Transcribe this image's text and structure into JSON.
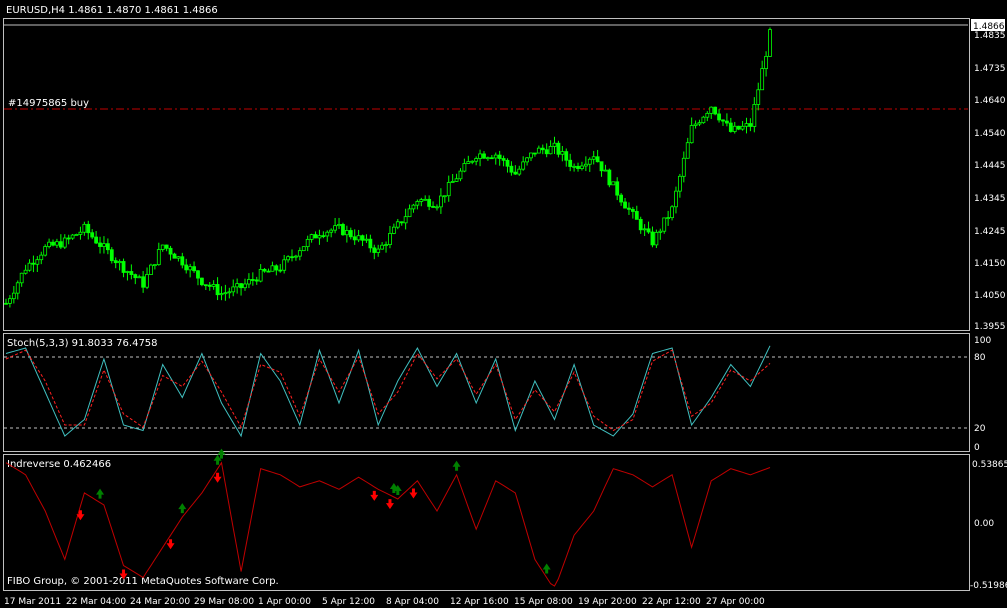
{
  "title": "EURUSD,H4  1.4861  1.4870  1.4861  1.4866",
  "order_label": "#14975865 buy",
  "copyright": "FIBO Group, © 2001-2011 MetaQuotes Software Corp.",
  "colors": {
    "background": "#000000",
    "frame": "#c0c0c0",
    "bull": "#00ff00",
    "bear": "#00ff00",
    "order_line": "#c00000",
    "stoch_main": "#40c0c0",
    "stoch_signal": "#ff2020",
    "indreverse": "#c00000",
    "arrow_up": "#008000",
    "arrow_down": "#ff0000"
  },
  "price_pane": {
    "current_price": "1.4866",
    "order_price": 1.4615,
    "y_min": 1.394,
    "y_max": 1.4878,
    "price_ticks": [
      "1.4835",
      "1.4735",
      "1.4640",
      "1.4540",
      "1.4445",
      "1.4345",
      "1.4245",
      "1.4150",
      "1.4050",
      "1.3955"
    ]
  },
  "stoch_pane": {
    "label": "Stoch(5,3,3) 91.8033 76.4758",
    "ticks": [
      "100",
      "80",
      "20",
      "0"
    ],
    "levels": [
      80,
      20
    ]
  },
  "indreverse_pane": {
    "label": "Indreverse 0.462466",
    "ticks": [
      "0.53865",
      "0.00",
      "-0.51986"
    ]
  },
  "x_axis": {
    "labels": [
      "17 Mar 2011",
      "22 Mar 04:00",
      "24 Mar 20:00",
      "29 Mar 08:00",
      "1 Apr 00:00",
      "5 Apr 12:00",
      "8 Apr 04:00",
      "12 Apr 16:00",
      "15 Apr 08:00",
      "19 Apr 20:00",
      "22 Apr 12:00",
      "27 Apr 00:00"
    ]
  },
  "chart_data": {
    "type": "line",
    "symbol": "EURUSD",
    "timeframe": "H4",
    "series": [
      {
        "name": "EURUSD,H4",
        "x_index": [
          0,
          5,
          10,
          15,
          20,
          25,
          30,
          35,
          40,
          45,
          50,
          55,
          60,
          65,
          70,
          75,
          80,
          85,
          90,
          95,
          100,
          105,
          110,
          115,
          120,
          125,
          130,
          135,
          140,
          145,
          150,
          155,
          160,
          165,
          170,
          175,
          180,
          185,
          190,
          195
        ],
        "values": [
          1.401,
          1.412,
          1.418,
          1.42,
          1.424,
          1.418,
          1.412,
          1.407,
          1.419,
          1.414,
          1.408,
          1.404,
          1.406,
          1.41,
          1.412,
          1.418,
          1.423,
          1.424,
          1.421,
          1.417,
          1.425,
          1.433,
          1.432,
          1.44,
          1.447,
          1.447,
          1.441,
          1.448,
          1.449,
          1.443,
          1.447,
          1.437,
          1.428,
          1.42,
          1.43,
          1.455,
          1.462,
          1.454,
          1.456,
          1.484
        ]
      },
      {
        "name": "Stoch main",
        "x_index": [
          0,
          5,
          10,
          15,
          20,
          25,
          30,
          35,
          40,
          45,
          50,
          55,
          60,
          65,
          70,
          75,
          80,
          85,
          90,
          95,
          100,
          105,
          110,
          115,
          120,
          125,
          130,
          135,
          140,
          145,
          150,
          155,
          160,
          165,
          170,
          175,
          180,
          185,
          190,
          195
        ],
        "values": [
          85,
          90,
          50,
          10,
          25,
          80,
          20,
          15,
          75,
          45,
          85,
          40,
          10,
          85,
          60,
          20,
          88,
          40,
          88,
          20,
          60,
          90,
          55,
          85,
          40,
          80,
          15,
          60,
          25,
          75,
          20,
          10,
          30,
          85,
          90,
          20,
          45,
          75,
          55,
          92
        ]
      },
      {
        "name": "Stoch signal",
        "x_index": [
          0,
          5,
          10,
          15,
          20,
          25,
          30,
          35,
          40,
          45,
          50,
          55,
          60,
          65,
          70,
          75,
          80,
          85,
          90,
          95,
          100,
          105,
          110,
          115,
          120,
          125,
          130,
          135,
          140,
          145,
          150,
          155,
          160,
          165,
          170,
          175,
          180,
          185,
          190,
          195
        ],
        "values": [
          80,
          88,
          60,
          20,
          20,
          70,
          30,
          18,
          65,
          55,
          78,
          50,
          18,
          75,
          68,
          28,
          80,
          50,
          82,
          30,
          50,
          85,
          62,
          80,
          48,
          75,
          25,
          52,
          32,
          68,
          28,
          15,
          25,
          78,
          88,
          28,
          40,
          70,
          60,
          76
        ]
      },
      {
        "name": "Indreverse",
        "x_index": [
          0,
          5,
          10,
          15,
          20,
          25,
          30,
          35,
          40,
          45,
          50,
          55,
          60,
          65,
          70,
          75,
          80,
          85,
          90,
          95,
          100,
          105,
          110,
          115,
          120,
          125,
          130,
          135,
          140,
          145,
          150,
          155,
          160,
          165,
          170,
          175,
          180,
          185,
          190,
          195
        ],
        "values": [
          0.5,
          0.4,
          0.1,
          -0.3,
          0.25,
          0.15,
          -0.35,
          -0.45,
          -0.2,
          0.05,
          0.25,
          0.5,
          -0.4,
          0.45,
          0.4,
          0.3,
          0.35,
          0.28,
          0.38,
          0.28,
          0.2,
          0.35,
          0.1,
          0.4,
          -0.05,
          0.35,
          0.25,
          -0.3,
          -0.55,
          -0.1,
          0.1,
          0.45,
          0.4,
          0.3,
          0.4,
          -0.2,
          0.35,
          0.45,
          0.4,
          0.46
        ]
      }
    ],
    "x_labels": [
      "17 Mar 2011",
      "22 Mar 04:00",
      "24 Mar 20:00",
      "29 Mar 08:00",
      "1 Apr 00:00",
      "5 Apr 12:00",
      "8 Apr 04:00",
      "12 Apr 16:00",
      "15 Apr 08:00",
      "19 Apr 20:00",
      "22 Apr 12:00",
      "27 Apr 00:00"
    ],
    "up_arrows_x": [
      24,
      45,
      55,
      54,
      99,
      100,
      115,
      138
    ],
    "down_arrows_x": [
      19,
      30,
      42,
      54,
      94,
      98,
      104
    ],
    "ylim_price": [
      1.394,
      1.4878
    ],
    "ylim_stoch": [
      0,
      100
    ],
    "ylim_indreverse": [
      -0.51986,
      0.53865
    ]
  }
}
